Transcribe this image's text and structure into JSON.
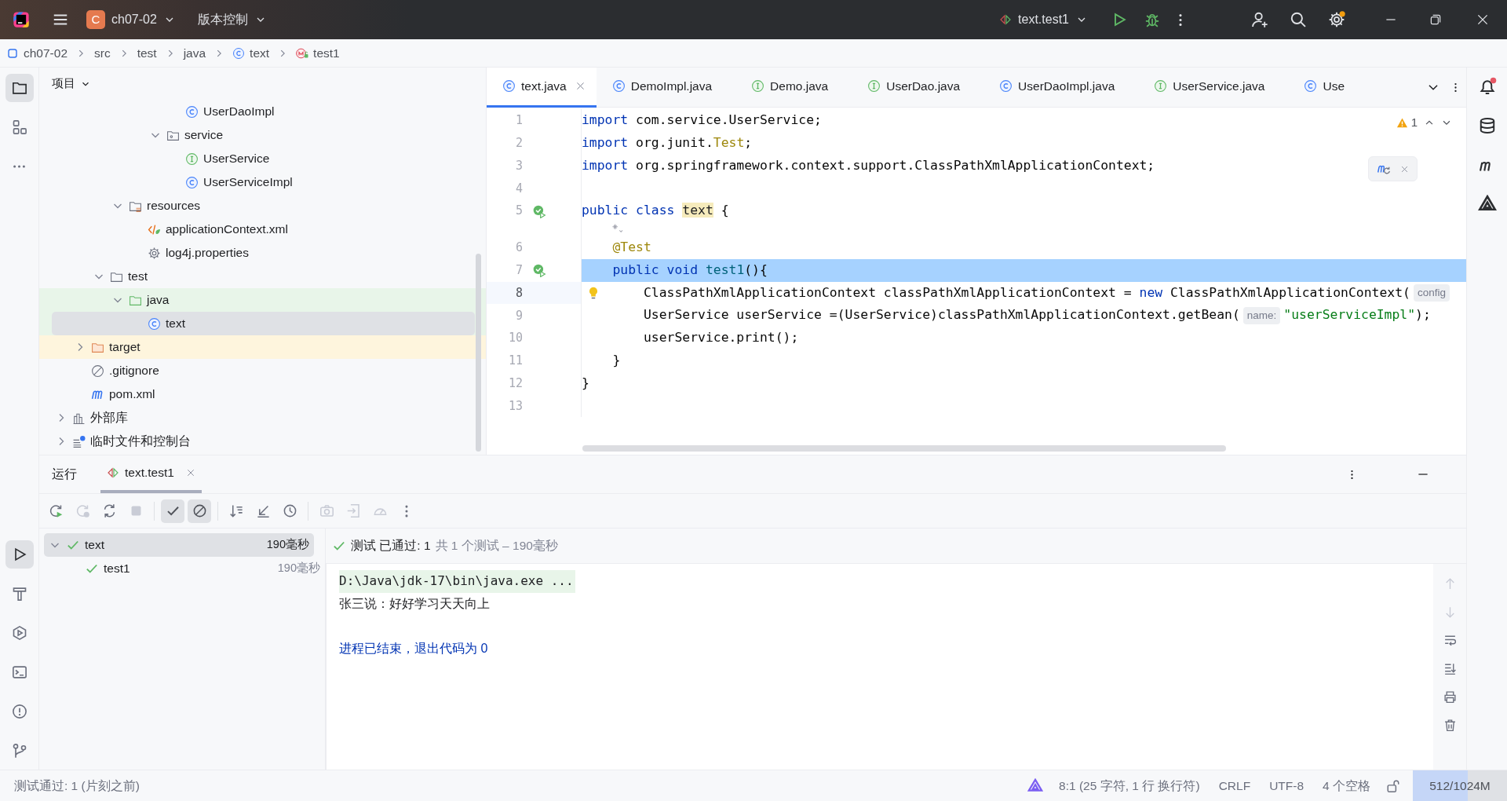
{
  "title_bar": {
    "project_badge": "C",
    "project": "ch07-02",
    "vcs_menu": "版本控制",
    "run_configuration": "text.test1"
  },
  "breadcrumb": [
    {
      "label": "ch07-02",
      "kind": "module"
    },
    {
      "label": "src",
      "kind": "dir"
    },
    {
      "label": "test",
      "kind": "dir"
    },
    {
      "label": "java",
      "kind": "dir"
    },
    {
      "label": "text",
      "kind": "class"
    },
    {
      "label": "test1",
      "kind": "method"
    }
  ],
  "left_toolbar": {
    "top": [
      {
        "kind": "project",
        "selected": true
      },
      {
        "kind": "structure",
        "selected": false
      },
      {
        "kind": "more",
        "selected": false
      }
    ],
    "bottom": [
      {
        "kind": "run",
        "selected": true
      },
      {
        "kind": "build",
        "selected": false
      },
      {
        "kind": "services",
        "selected": false
      },
      {
        "kind": "terminal",
        "selected": false
      },
      {
        "kind": "problems",
        "selected": false
      },
      {
        "kind": "git",
        "selected": false
      }
    ]
  },
  "right_toolbar": [
    {
      "kind": "notifications"
    },
    {
      "kind": "database"
    },
    {
      "kind": "maven"
    },
    {
      "kind": "ai"
    }
  ],
  "project_panel": {
    "title": "项目",
    "tree": [
      {
        "children": [
          {
            "children": [
              {
                "children": [
                  {
                    "children": [
                      {
                        "children": [
                          {
                            "children": [
                              {
                                "label": "UserDaoImpl",
                                "kind": "class",
                                "selected": false
                              }
                            ]
                          },
                          {
                            "label": "service",
                            "kind": "package",
                            "expanded": true,
                            "selected": false,
                            "children": [
                              {
                                "label": "UserService",
                                "kind": "interface",
                                "selected": false
                              },
                              {
                                "label": "UserServiceImpl",
                                "kind": "class",
                                "selected": false
                              }
                            ]
                          }
                        ]
                      }
                    ]
                  },
                  {
                    "label": "resources",
                    "kind": "resources",
                    "expanded": true,
                    "selected": false,
                    "children": [
                      {
                        "label": "applicationContext.xml",
                        "kind": "xml",
                        "selected": false
                      },
                      {
                        "label": "log4j.properties",
                        "kind": "properties",
                        "selected": false
                      }
                    ]
                  }
                ]
              },
              {
                "label": "test",
                "kind": "folder",
                "expanded": true,
                "selected": false,
                "children": [
                  {
                    "label": "java",
                    "kind": "test-folder",
                    "expanded": true,
                    "selected": false,
                    "children": [
                      {
                        "label": "text",
                        "kind": "class",
                        "selected": true
                      }
                    ]
                  }
                ]
              }
            ]
          },
          {
            "label": "target",
            "kind": "excluded-folder",
            "expanded": false,
            "selected": false
          },
          {
            "label": ".gitignore",
            "kind": "ignore",
            "selected": false
          },
          {
            "label": "pom.xml",
            "kind": "maven",
            "selected": false
          }
        ]
      },
      {
        "label": "外部库",
        "kind": "library",
        "expanded": false,
        "selected": false
      },
      {
        "label": "临时文件和控制台",
        "kind": "scratches",
        "expanded": false,
        "selected": false
      }
    ]
  },
  "editor": {
    "tabs": [
      {
        "label": "text.java",
        "kind": "class",
        "selected": true
      },
      {
        "label": "DemoImpl.java",
        "kind": "class",
        "selected": false
      },
      {
        "label": "Demo.java",
        "kind": "interface",
        "selected": false
      },
      {
        "label": "UserDao.java",
        "kind": "interface",
        "selected": false
      },
      {
        "label": "UserDaoImpl.java",
        "kind": "class",
        "selected": false
      },
      {
        "label": "UserService.java",
        "kind": "interface",
        "selected": false
      },
      {
        "label": "Use",
        "kind": "class",
        "selected": false
      }
    ],
    "warning_count": "1",
    "lines": [
      {
        "kind": "code",
        "number": "1",
        "selected": false,
        "current": false,
        "run_marker": false,
        "bulb": false,
        "segments": [
          {
            "text": "import",
            "kind": "keyword"
          },
          {
            "text": " com.service.UserService;",
            "kind": "plain"
          }
        ]
      },
      {
        "kind": "code",
        "number": "2",
        "selected": false,
        "current": false,
        "run_marker": false,
        "bulb": false,
        "segments": [
          {
            "text": "import",
            "kind": "keyword"
          },
          {
            "text": " org.junit.",
            "kind": "plain"
          },
          {
            "text": "Test",
            "kind": "annotation"
          },
          {
            "text": ";",
            "kind": "plain"
          }
        ]
      },
      {
        "kind": "code",
        "number": "3",
        "selected": false,
        "current": false,
        "run_marker": false,
        "bulb": false,
        "segments": [
          {
            "text": "import",
            "kind": "keyword"
          },
          {
            "text": " org.springframework.context.support.ClassPathXmlApplicationContext;",
            "kind": "plain"
          }
        ]
      },
      {
        "kind": "code",
        "number": "4",
        "selected": false,
        "current": false,
        "run_marker": false,
        "bulb": false
      },
      {
        "kind": "code",
        "number": "5",
        "selected": false,
        "current": false,
        "run_marker": true,
        "bulb": false,
        "segments": [
          {
            "text": "public class ",
            "kind": "keyword"
          },
          {
            "text": "text",
            "kind": "usage"
          },
          {
            "text": " {",
            "kind": "plain"
          }
        ]
      },
      {
        "kind": "inlay"
      },
      {
        "kind": "code",
        "number": "6",
        "selected": false,
        "current": false,
        "run_marker": false,
        "bulb": false,
        "segments": [
          {
            "text": "    @Test",
            "kind": "annotation"
          }
        ]
      },
      {
        "kind": "code",
        "number": "7",
        "selected": true,
        "current": false,
        "run_marker": true,
        "bulb": false,
        "segments": [
          {
            "text": "    public void ",
            "kind": "keyword"
          },
          {
            "text": "test1",
            "kind": "declaration"
          },
          {
            "text": "(){",
            "kind": "plain"
          }
        ]
      },
      {
        "kind": "code",
        "number": "8",
        "selected": false,
        "current": true,
        "run_marker": false,
        "bulb": true,
        "segments": [
          {
            "text": "        ClassPathXmlApplicationContext classPathXmlApplicationContext = ",
            "kind": "plain"
          },
          {
            "text": "new",
            "kind": "keyword"
          },
          {
            "text": " ClassPathXmlApplicationContext(",
            "kind": "plain"
          },
          {
            "text": "config",
            "kind": "hint"
          }
        ]
      },
      {
        "kind": "code",
        "number": "9",
        "selected": false,
        "current": false,
        "run_marker": false,
        "bulb": false,
        "segments": [
          {
            "text": "        UserService userService =(UserService)classPathXmlApplicationContext.getBean(",
            "kind": "plain"
          },
          {
            "text": "name:",
            "kind": "hint"
          },
          {
            "text": "\"userServiceImpl\"",
            "kind": "string"
          },
          {
            "text": ");",
            "kind": "plain"
          }
        ]
      },
      {
        "kind": "code",
        "number": "10",
        "selected": false,
        "current": false,
        "run_marker": false,
        "bulb": false,
        "segments": [
          {
            "text": "        userService.print();",
            "kind": "plain"
          }
        ]
      },
      {
        "kind": "code",
        "number": "11",
        "selected": false,
        "current": false,
        "run_marker": false,
        "bulb": false,
        "segments": [
          {
            "text": "    }",
            "kind": "plain"
          }
        ]
      },
      {
        "kind": "code",
        "number": "12",
        "selected": false,
        "current": false,
        "run_marker": false,
        "bulb": false,
        "segments": [
          {
            "text": "}",
            "kind": "plain"
          }
        ]
      },
      {
        "kind": "code",
        "number": "13",
        "selected": false,
        "current": false,
        "run_marker": false,
        "bulb": false
      }
    ]
  },
  "run_panel": {
    "title": "运行",
    "tabs": [
      {
        "label": "text.test1",
        "selected": true
      }
    ],
    "toolbar_groups": [
      [
        {
          "kind": "rerun",
          "disabled": false,
          "toggled": false
        },
        {
          "kind": "rerun-failed",
          "disabled": true,
          "toggled": false
        },
        {
          "kind": "auto-rerun",
          "disabled": false,
          "toggled": false
        },
        {
          "kind": "stop",
          "disabled": true,
          "toggled": false
        }
      ],
      [
        {
          "kind": "show-passed",
          "disabled": false,
          "toggled": true
        },
        {
          "kind": "show-ignored",
          "disabled": false,
          "toggled": true
        }
      ],
      [
        {
          "kind": "sort",
          "disabled": false,
          "toggled": false
        },
        {
          "kind": "collapse",
          "disabled": false,
          "toggled": false
        },
        {
          "kind": "history",
          "disabled": false,
          "toggled": false
        }
      ],
      [
        {
          "kind": "snapshot",
          "disabled": true,
          "toggled": false
        },
        {
          "kind": "import",
          "disabled": true,
          "toggled": false
        },
        {
          "kind": "profile",
          "disabled": true,
          "toggled": false
        },
        {
          "kind": "more",
          "disabled": false,
          "toggled": false
        }
      ]
    ],
    "tests": [
      {
        "label": "text",
        "time": "190毫秒",
        "passed": true,
        "selected": true,
        "expanded": true,
        "children": [
          {
            "label": "test1",
            "time": "190毫秒",
            "passed": true,
            "selected": false
          }
        ]
      }
    ],
    "summary": {
      "passed": true,
      "status": "测试 已通过: 1",
      "detail": "共 1 个测试 – 190毫秒"
    },
    "console": [
      {
        "kind": "command",
        "text": "D:\\Java\\jdk-17\\bin\\java.exe ..."
      },
      {
        "kind": "stdout",
        "text": "张三说：好好学习天天向上"
      },
      {
        "kind": "blank"
      },
      {
        "kind": "system",
        "text": "进程已结束，退出代码为 0"
      }
    ],
    "console_tools": [
      {
        "kind": "up",
        "disabled": true
      },
      {
        "kind": "down",
        "disabled": true
      },
      {
        "kind": "wrap",
        "disabled": false
      },
      {
        "kind": "scroll-end",
        "disabled": false
      },
      {
        "kind": "print",
        "disabled": false
      },
      {
        "kind": "clear",
        "disabled": false
      }
    ]
  },
  "status_bar": {
    "message": "测试通过: 1 (片刻之前)",
    "position": "8:1 (25 字符, 1 行 换行符)",
    "line_separator": "CRLF",
    "encoding": "UTF-8",
    "indent": "4 个空格",
    "memory": {
      "text": "512/1024M",
      "level": 0.58
    }
  }
}
